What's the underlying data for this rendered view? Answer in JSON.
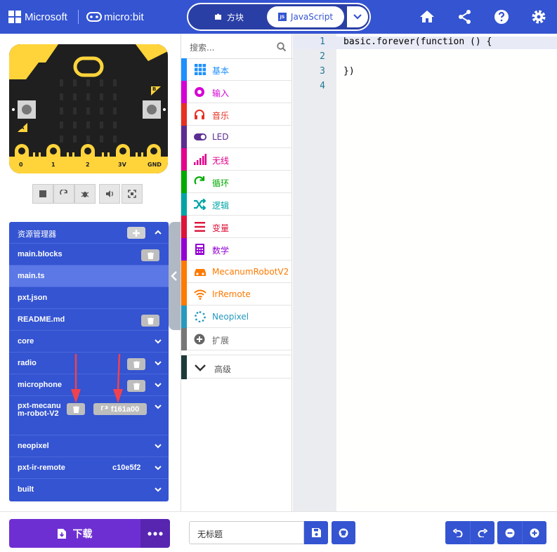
{
  "header": {
    "brand": "Microsoft",
    "product": "micro:bit",
    "mode_blocks": "方块",
    "mode_js": "JavaScript",
    "icons": [
      "home-icon",
      "share-icon",
      "help-icon",
      "settings-icon"
    ]
  },
  "simulator": {
    "pin_labels": [
      "0",
      "1",
      "2",
      "3V",
      "GND"
    ],
    "button_a": "A",
    "button_b": "B",
    "controls": [
      "stop-icon",
      "restart-icon",
      "debug-icon",
      "sound-icon",
      "fullscreen-icon"
    ]
  },
  "explorer": {
    "title": "资源管理器",
    "files": [
      {
        "name": "main.blocks",
        "trash": true,
        "selected": false
      },
      {
        "name": "main.ts",
        "trash": false,
        "selected": true
      },
      {
        "name": "pxt.json",
        "trash": false,
        "selected": false
      },
      {
        "name": "README.md",
        "trash": true,
        "selected": false
      },
      {
        "name": "core",
        "trash": false,
        "chevron": true
      },
      {
        "name": "radio",
        "trash": true,
        "chevron": true
      },
      {
        "name": "microphone",
        "trash": true,
        "chevron": true
      },
      {
        "name": "pxt-mecanum-robot-V2",
        "trash": true,
        "chevron": true,
        "version": "f161a00"
      },
      {
        "name": "neopixel",
        "trash": false,
        "chevron": true
      },
      {
        "name": "pxt-ir-remote",
        "trash": false,
        "chevron": true,
        "version": "c10e5f2"
      },
      {
        "name": "built",
        "trash": false,
        "chevron": true
      }
    ]
  },
  "toolbox": {
    "search_placeholder": "搜索...",
    "categories": [
      {
        "label": "基本",
        "color": "#1e90ff",
        "icon": "grid-icon"
      },
      {
        "label": "输入",
        "color": "#d400d4",
        "icon": "target-icon"
      },
      {
        "label": "音乐",
        "color": "#e63022",
        "icon": "headphones-icon"
      },
      {
        "label": "LED",
        "color": "#5c2d91",
        "icon": "toggle-icon"
      },
      {
        "label": "无线",
        "color": "#e3008c",
        "icon": "signal-icon"
      },
      {
        "label": "循环",
        "color": "#00aa00",
        "icon": "refresh-icon"
      },
      {
        "label": "逻辑",
        "color": "#00a4a6",
        "icon": "shuffle-icon"
      },
      {
        "label": "变量",
        "color": "#dc143c",
        "icon": "list-icon"
      },
      {
        "label": "数学",
        "color": "#9400d3",
        "icon": "calculator-icon"
      },
      {
        "label": "MecanumRobotV2",
        "color": "#ff7a00",
        "icon": "car-icon"
      },
      {
        "label": "IrRemote",
        "color": "#ff7a00",
        "icon": "wifi-icon"
      },
      {
        "label": "Neopixel",
        "color": "#2699bf",
        "icon": "dots-icon"
      },
      {
        "label": "扩展",
        "color": "#777777",
        "icon": "plus-circle-icon"
      }
    ],
    "advanced": "高级"
  },
  "editor": {
    "lines": [
      {
        "n": "1",
        "text": "basic.forever(function () {"
      },
      {
        "n": "2",
        "text": ""
      },
      {
        "n": "3",
        "text": "})"
      },
      {
        "n": "4",
        "text": ""
      }
    ]
  },
  "footer": {
    "download_label": "下载",
    "project_name": "无标题",
    "icons": [
      "save-icon",
      "github-icon",
      "undo-icon",
      "redo-icon",
      "zoom-out-icon",
      "zoom-in-icon"
    ]
  }
}
